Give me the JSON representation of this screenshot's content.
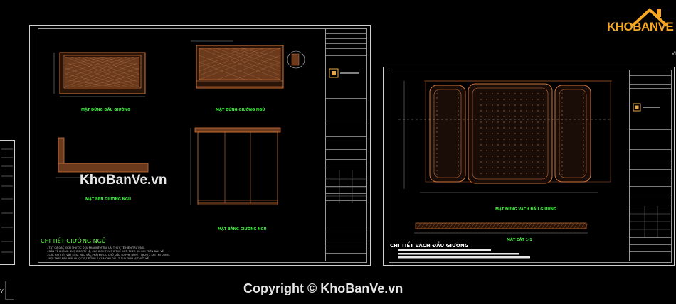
{
  "brand": {
    "logo_text": "KHOBANVE",
    "accent": "#f5a623",
    "logo_tag": "KHOBANVE"
  },
  "watermark": {
    "center": "KhoBanVe.vn",
    "bottom": "Copyright © KhoBanVe.vn"
  },
  "ucs": {
    "axis_label": "Y"
  },
  "left_sheet": {
    "section_title": "CHI TIẾT GIƯỜNG NGỦ",
    "views": [
      "MẶT ĐỨNG ĐẦU GIƯỜNG",
      "MẶT ĐỨNG GIƯỜNG NGỦ",
      "MẶT BÊN GIƯỜNG NGỦ",
      "MẶT BẰNG GIƯỜNG NGỦ"
    ],
    "notes": [
      "- TẤT CẢ CÁC KÍCH THƯỚC ĐỀU PHẢI KIỂM TRA LẠI THỰC TẾ HIỆN TRƯỜNG.",
      "- BẢN VẼ KHÔNG ĐƯỢC ĐO TỶ LỆ, CÁC KÍCH THƯỚC THỂ HIỆN THEO SỐ GHI TRÊN BẢN VẼ.",
      "- CÁC CHI TIẾT VẬT LIỆU, MÀU SẮC PHẢI ĐƯỢC CHỦ ĐẦU TƯ PHÊ DUYỆT TRƯỚC KHI THI CÔNG.",
      "- MỌI THAY ĐỔI PHẢI ĐƯỢC SỰ ĐỒNG Ý CỦA CHỦ ĐẦU TƯ VÀ ĐƠN VỊ THIẾT KẾ."
    ]
  },
  "right_sheet": {
    "section_title": "CHI TIẾT VÁCH ĐẦU GIƯỜNG",
    "views": [
      "MẶT ĐỨNG VÁCH ĐẦU GIƯỜNG",
      "MẶT CẮT 1-1"
    ]
  }
}
